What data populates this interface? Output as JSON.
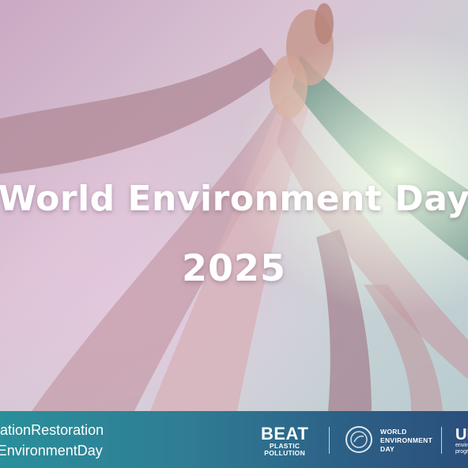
{
  "hero": {
    "title_line1": "World Environment Day",
    "title_line2": "2025"
  },
  "footer": {
    "hashtag_line1": "#GenerationRestoration",
    "hashtag_line2": "#WorldEnvironmentDay",
    "beat_logo": {
      "line1": "BEAT",
      "line2": "PLASTIC",
      "line3": "POLLUTION"
    },
    "wed_logo": {
      "line1": "WORLD",
      "line2": "ENVIRONMENT",
      "line3": "DAY"
    },
    "un_logo": {
      "big": "UN",
      "small1": "environment",
      "small2": "programme"
    }
  },
  "colors": {
    "footer_start": "#2a8f9a",
    "footer_end": "#2b4f7c",
    "headline": "#ffffff"
  }
}
